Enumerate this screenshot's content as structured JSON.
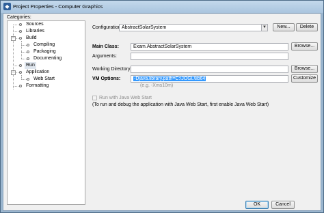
{
  "window": {
    "title": "Project Properties - Computer Graphics",
    "icon": "netbeans-icon"
  },
  "categories": {
    "label": "Categories:",
    "items": [
      {
        "label": "Sources",
        "level": 1,
        "type": "leaf"
      },
      {
        "label": "Libraries",
        "level": 1,
        "type": "leaf"
      },
      {
        "label": "Build",
        "level": 1,
        "type": "expanded"
      },
      {
        "label": "Compiling",
        "level": 2,
        "type": "leaf"
      },
      {
        "label": "Packaging",
        "level": 2,
        "type": "leaf"
      },
      {
        "label": "Documenting",
        "level": 2,
        "type": "leaf"
      },
      {
        "label": "Run",
        "level": 1,
        "type": "leaf",
        "selected": true
      },
      {
        "label": "Application",
        "level": 1,
        "type": "expanded"
      },
      {
        "label": "Web Start",
        "level": 2,
        "type": "leaf"
      },
      {
        "label": "Formatting",
        "level": 1,
        "type": "leaf"
      }
    ]
  },
  "run": {
    "configuration_label": "Configuration:",
    "configuration_value": "AbstractSolarSystem",
    "new_button": "New...",
    "delete_button": "Delete",
    "main_class_label": "Main Class:",
    "main_class_value": "Exam.AbstractSolarSystem",
    "browse_button": "Browse...",
    "arguments_label": "Arguments:",
    "arguments_value": "",
    "working_dir_label": "Working Directory:",
    "working_dir_value": "",
    "vm_options_label": "VM Options:",
    "vm_options_value": "-Djava.library.path=C:\\JOGL\\lib64",
    "customize_button": "Customize",
    "vm_hint": "(e.g. -Xms10m)",
    "web_start_checkbox_label": "Run with Java Web Start",
    "web_start_checked": false,
    "web_start_note": "(To run and debug the application with Java Web Start, first enable Java Web Start)"
  },
  "footer": {
    "ok_button": "OK",
    "cancel_button": "Cancel"
  }
}
